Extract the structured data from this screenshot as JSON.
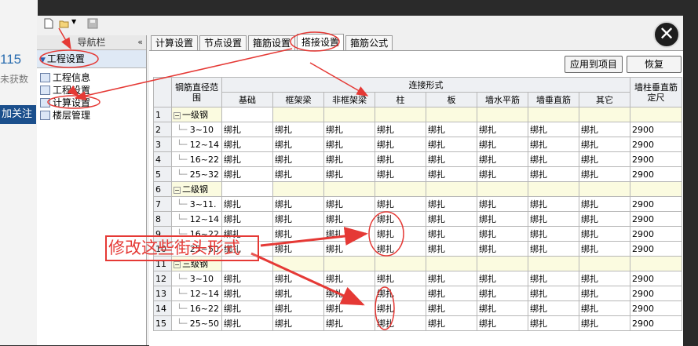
{
  "background": {
    "number": "115",
    "subtext": "未获数",
    "follow": "加关注"
  },
  "navigator": {
    "title": "导航栏",
    "collapse_glyph": "«",
    "section": "工程设置",
    "items": [
      {
        "label": "工程信息",
        "icon": "info-icon"
      },
      {
        "label": "工程设置",
        "icon": "project-settings-icon"
      },
      {
        "label": "计算设置",
        "icon": "calc-settings-icon"
      },
      {
        "label": "楼层管理",
        "icon": "floor-icon"
      }
    ]
  },
  "tabs": [
    "计算设置",
    "节点设置",
    "箍筋设置",
    "搭接设置",
    "箍筋公式"
  ],
  "active_tab": "搭接设置",
  "buttons": {
    "apply": "应用到项目",
    "restore": "恢复"
  },
  "table": {
    "col_range": "钢筋直径范围",
    "group_header": "连接形式",
    "col_last": "墙柱垂直筋定尺",
    "columns": [
      "基础",
      "框架梁",
      "非框架梁",
      "柱",
      "板",
      "墙水平筋",
      "墙垂直筋",
      "其它"
    ],
    "rows": [
      {
        "n": "1",
        "group": true,
        "label": "一级钢"
      },
      {
        "n": "2",
        "label": "3~10",
        "vals": [
          "绑扎",
          "绑扎",
          "绑扎",
          "绑扎",
          "绑扎",
          "绑扎",
          "绑扎",
          "绑扎"
        ],
        "len": "2900"
      },
      {
        "n": "3",
        "label": "12~14",
        "vals": [
          "绑扎",
          "绑扎",
          "绑扎",
          "绑扎",
          "绑扎",
          "绑扎",
          "绑扎",
          "绑扎"
        ],
        "len": "2900"
      },
      {
        "n": "4",
        "label": "16~22",
        "vals": [
          "绑扎",
          "绑扎",
          "绑扎",
          "绑扎",
          "绑扎",
          "绑扎",
          "绑扎",
          "绑扎"
        ],
        "len": "2900"
      },
      {
        "n": "5",
        "label": "25~32",
        "vals": [
          "绑扎",
          "绑扎",
          "绑扎",
          "绑扎",
          "绑扎",
          "绑扎",
          "绑扎",
          "绑扎"
        ],
        "len": "2900"
      },
      {
        "n": "6",
        "group": true,
        "label": "二级钢"
      },
      {
        "n": "7",
        "label": "3~11.",
        "vals": [
          "绑扎",
          "绑扎",
          "绑扎",
          "绑扎",
          "绑扎",
          "绑扎",
          "绑扎",
          "绑扎"
        ],
        "len": "2900"
      },
      {
        "n": "8",
        "label": "12~14",
        "vals": [
          "绑扎",
          "绑扎",
          "绑扎",
          "绑扎",
          "绑扎",
          "绑扎",
          "绑扎",
          "绑扎"
        ],
        "len": "2900"
      },
      {
        "n": "9",
        "label": "16~22",
        "vals": [
          "绑扎",
          "绑扎",
          "绑扎",
          "绑扎",
          "绑扎",
          "绑扎",
          "绑扎",
          "绑扎"
        ],
        "len": "2900"
      },
      {
        "n": "10",
        "label": "25~50",
        "vals": [
          "绑扎",
          "绑扎",
          "绑扎",
          "绑扎",
          "绑扎",
          "绑扎",
          "绑扎",
          "绑扎"
        ],
        "len": "2900"
      },
      {
        "n": "11",
        "group": true,
        "label": "三级钢"
      },
      {
        "n": "12",
        "label": "3~10",
        "vals": [
          "绑扎",
          "绑扎",
          "绑扎",
          "绑扎",
          "绑扎",
          "绑扎",
          "绑扎",
          "绑扎"
        ],
        "len": "2900"
      },
      {
        "n": "13",
        "label": "12~14",
        "vals": [
          "绑扎",
          "绑扎",
          "绑扎",
          "绑扎",
          "绑扎",
          "绑扎",
          "绑扎",
          "绑扎"
        ],
        "len": "2900"
      },
      {
        "n": "14",
        "label": "16~22",
        "vals": [
          "绑扎",
          "绑扎",
          "绑扎",
          "绑扎",
          "绑扎",
          "绑扎",
          "绑扎",
          "绑扎"
        ],
        "len": "2900"
      },
      {
        "n": "15",
        "label": "25~50",
        "vals": [
          "绑扎",
          "绑扎",
          "绑扎",
          "绑扎",
          "绑扎",
          "绑扎",
          "绑扎",
          "绑扎"
        ],
        "len": "2900"
      }
    ]
  },
  "annotation": {
    "text": "修改这些街头形式",
    "color": "#e53935"
  },
  "colors": {
    "group_row": "#fbfbe0",
    "header_bg": "#eef0f3",
    "nav_section": "#dfe9f5"
  }
}
